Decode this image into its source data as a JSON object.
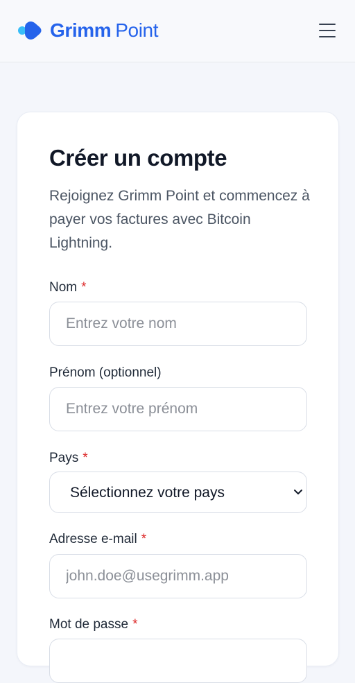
{
  "header": {
    "brand_primary": "Grimm",
    "brand_secondary": "Point",
    "menu_icon": "hamburger-menu-icon",
    "accent_color": "#2563eb",
    "logo_secondary_color": "#38bdf8"
  },
  "form": {
    "title": "Créer un compte",
    "subtitle": "Rejoignez Grimm Point et commencez à payer vos factures avec Bitcoin Lightning.",
    "required_mark": "*",
    "fields": {
      "name": {
        "label": "Nom",
        "placeholder": "Entrez votre nom",
        "value": ""
      },
      "first_name": {
        "label": "Prénom (optionnel)",
        "placeholder": "Entrez votre prénom",
        "value": ""
      },
      "country": {
        "label": "Pays",
        "selected_value": "Sélectionnez votre pays"
      },
      "email": {
        "label": "Adresse e-mail",
        "placeholder": "john.doe@usegrimm.app",
        "value": ""
      },
      "password": {
        "label": "Mot de passe",
        "placeholder": "",
        "value": ""
      }
    }
  }
}
